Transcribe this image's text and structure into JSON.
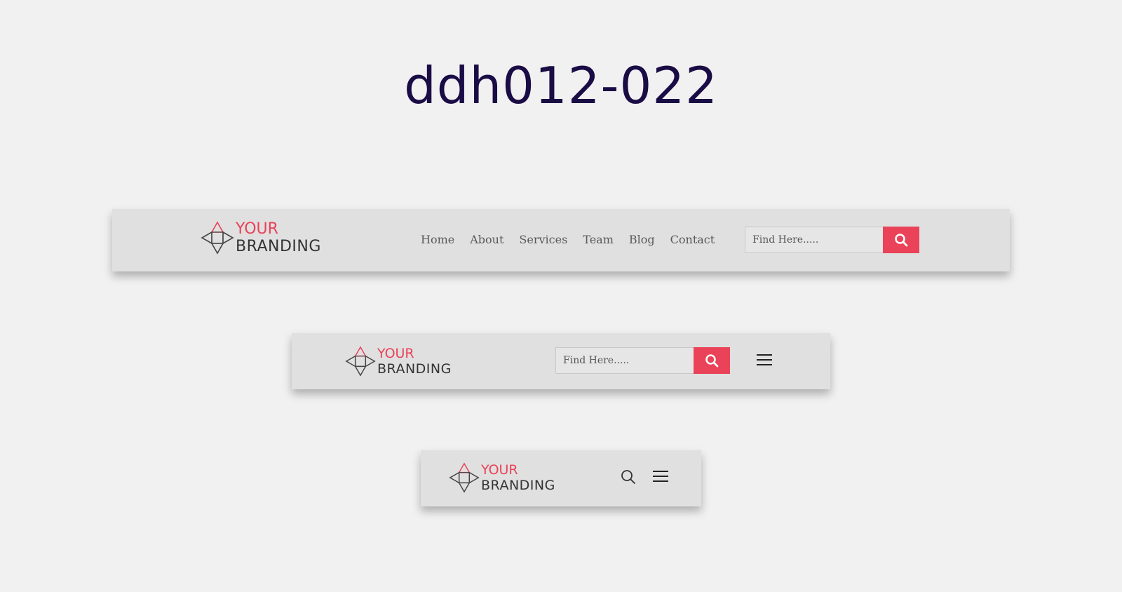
{
  "page": {
    "title": "ddh012-022"
  },
  "logo": {
    "line1": "YOUR",
    "line2": "BRANDING"
  },
  "nav": {
    "items": [
      "Home",
      "About",
      "Services",
      "Team",
      "Blog",
      "Contact"
    ]
  },
  "search": {
    "placeholder": "Find Here....."
  },
  "icons": {
    "logo": "logo-diamond-icon",
    "search_button": "search-icon",
    "menu": "hamburger-menu-icon"
  },
  "colors": {
    "background": "#f1f1f1",
    "bar": "#e0e0e0",
    "accent": "#ea4258",
    "title": "#1a0c45",
    "nav_text": "#595959"
  }
}
